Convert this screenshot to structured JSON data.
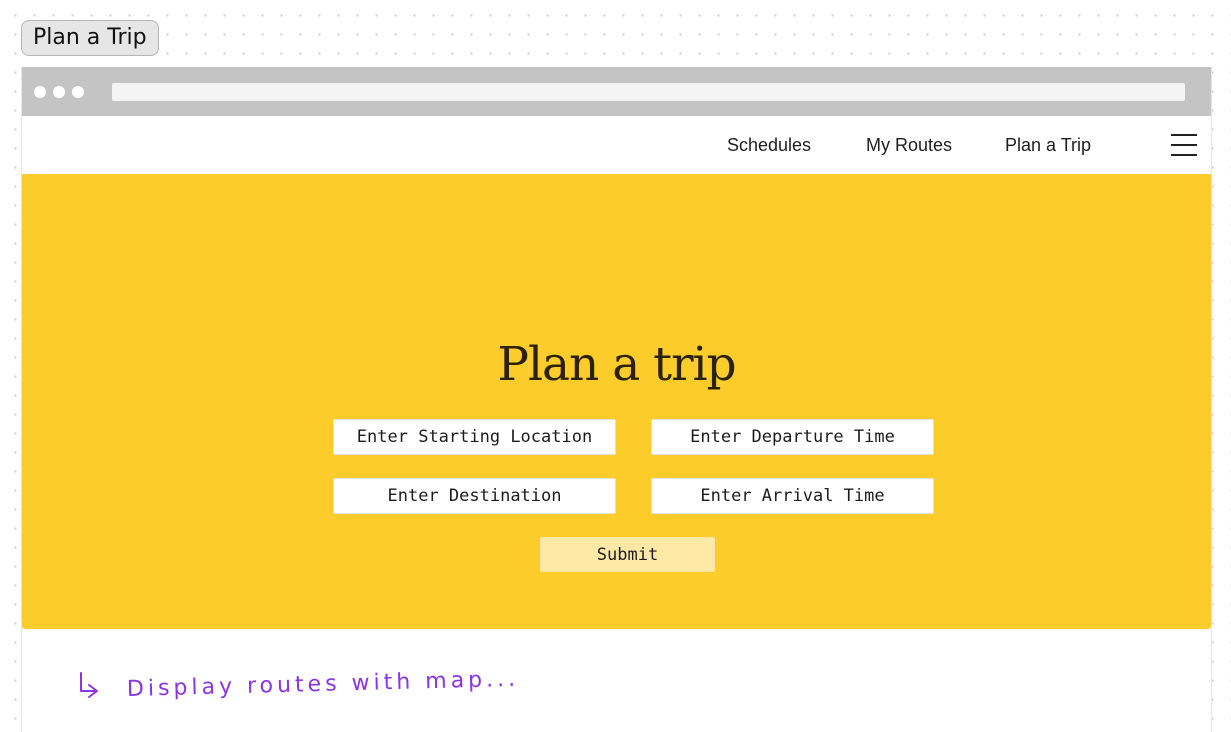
{
  "frame": {
    "label": "Plan a Trip"
  },
  "nav": {
    "items": [
      {
        "label": "Schedules"
      },
      {
        "label": "My Routes"
      },
      {
        "label": "Plan a Trip"
      }
    ],
    "menu_icon": "hamburger-menu-icon"
  },
  "hero": {
    "title": "Plan a trip",
    "fields": {
      "start": {
        "placeholder": "Enter Starting Location",
        "value": ""
      },
      "departure": {
        "placeholder": "Enter Departure Time",
        "value": ""
      },
      "destination": {
        "placeholder": "Enter Destination",
        "value": ""
      },
      "arrival": {
        "placeholder": "Enter Arrival Time",
        "value": ""
      }
    },
    "submit_label": "Submit"
  },
  "annotation": {
    "text": "Display routes with map..."
  },
  "colors": {
    "hero_background": "#fccd2a",
    "submit_background": "#fde9a5",
    "browser_chrome": "#c4c4c4",
    "annotation_ink": "#8b34e6"
  }
}
